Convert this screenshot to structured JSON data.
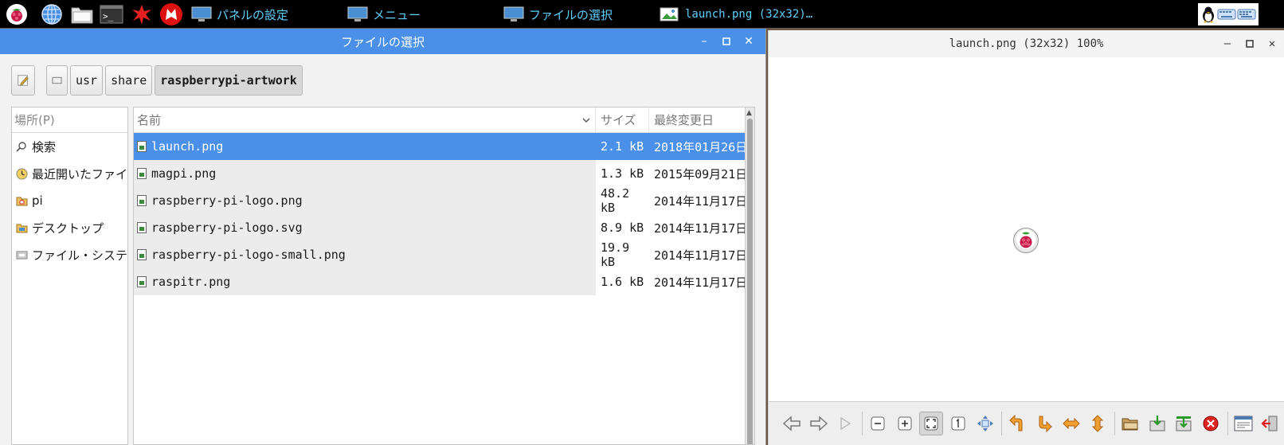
{
  "taskbar": {
    "tasks": [
      {
        "label": "パネルの設定"
      },
      {
        "label": "メニュー"
      },
      {
        "label": "ファイルの選択"
      },
      {
        "label": "launch.png (32x32)…"
      }
    ]
  },
  "file_chooser": {
    "title": "ファイルの選択",
    "path": [
      "usr",
      "share",
      "raspberrypi-artwork"
    ],
    "places_header": "場所(P)",
    "places": [
      {
        "label": "検索",
        "icon": "search-icon"
      },
      {
        "label": "最近開いたファイル",
        "icon": "recent-icon"
      },
      {
        "label": "pi",
        "icon": "home-folder-icon"
      },
      {
        "label": "デスクトップ",
        "icon": "desktop-folder-icon"
      },
      {
        "label": "ファイル・システム",
        "icon": "drive-icon"
      }
    ],
    "columns": {
      "name": "名前",
      "size": "サイズ",
      "date": "最終変更日"
    },
    "files": [
      {
        "name": "launch.png",
        "size": "2.1 kB",
        "date": "2018年01月26日",
        "selected": true
      },
      {
        "name": "magpi.png",
        "size": "1.3 kB",
        "date": "2015年09月21日"
      },
      {
        "name": "raspberry-pi-logo.png",
        "size": "48.2 kB",
        "date": "2014年11月17日"
      },
      {
        "name": "raspberry-pi-logo.svg",
        "size": "8.9 kB",
        "date": "2014年11月17日"
      },
      {
        "name": "raspberry-pi-logo-small.png",
        "size": "19.9 kB",
        "date": "2014年11月17日"
      },
      {
        "name": "raspitr.png",
        "size": "1.6 kB",
        "date": "2014年11月17日"
      }
    ]
  },
  "viewer": {
    "title": "launch.png (32x32) 100%"
  },
  "colors": {
    "selection": "#4a90e8",
    "task_text": "#5fd0ff",
    "raspberry": "#c51a4a"
  }
}
